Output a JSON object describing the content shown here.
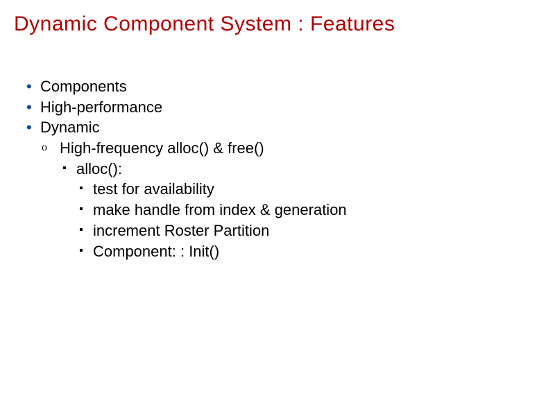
{
  "title": "Dynamic Component System : Features",
  "bullets": {
    "l1_0": "Components",
    "l1_1": "High-performance",
    "l1_2": "Dynamic",
    "l2_0": "High-frequency alloc() & free()",
    "l3_0": "alloc():",
    "l4_0": "test for availability",
    "l4_1": "make handle from index & generation",
    "l4_2": "increment Roster Partition",
    "l4_3": "Component: : Init()"
  },
  "markers": {
    "dot": "•",
    "circle": "o",
    "square": "▪"
  }
}
